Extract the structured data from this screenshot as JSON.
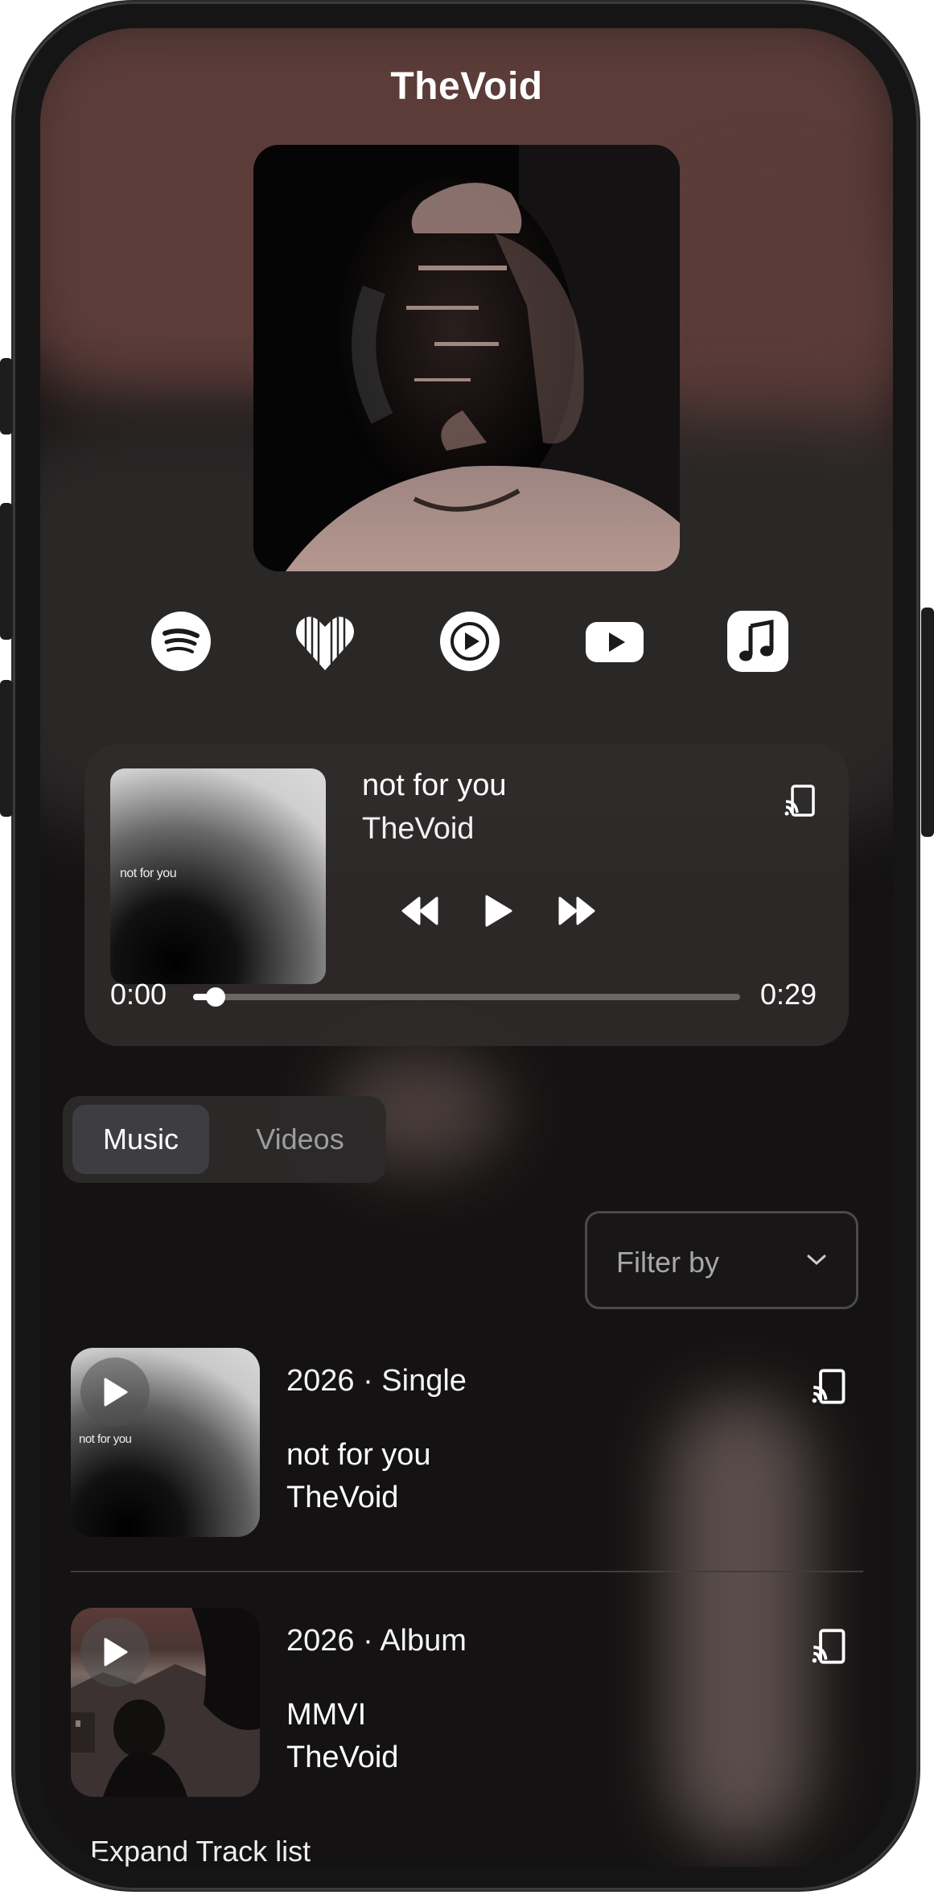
{
  "artist": {
    "name": "TheVoid"
  },
  "platforms": [
    {
      "name": "Spotify",
      "icon": "spotify-icon"
    },
    {
      "name": "Deezer",
      "icon": "deezer-heart-icon"
    },
    {
      "name": "YouTube Music",
      "icon": "youtube-music-icon"
    },
    {
      "name": "YouTube",
      "icon": "youtube-icon"
    },
    {
      "name": "Apple Music",
      "icon": "apple-music-icon"
    }
  ],
  "player": {
    "cover_text": "not for you",
    "title": "not for you",
    "artist": "TheVoid",
    "time_current": "0:00",
    "time_total": "0:29",
    "progress": 0.03
  },
  "tabs": [
    {
      "label": "Music",
      "active": true
    },
    {
      "label": "Videos",
      "active": false
    }
  ],
  "filter": {
    "label": "Filter by"
  },
  "tracks": [
    {
      "meta": "2026 · Single",
      "title": "not for you",
      "artist": "TheVoid",
      "cover_text": "not for you"
    },
    {
      "meta": "2026 · Album",
      "title": "MMVI",
      "artist": "TheVoid"
    }
  ],
  "expand_label": "Expand Track list",
  "colors": {
    "background": "#141212",
    "accent_blob": "#5a3b38",
    "card": "#302d2d"
  }
}
